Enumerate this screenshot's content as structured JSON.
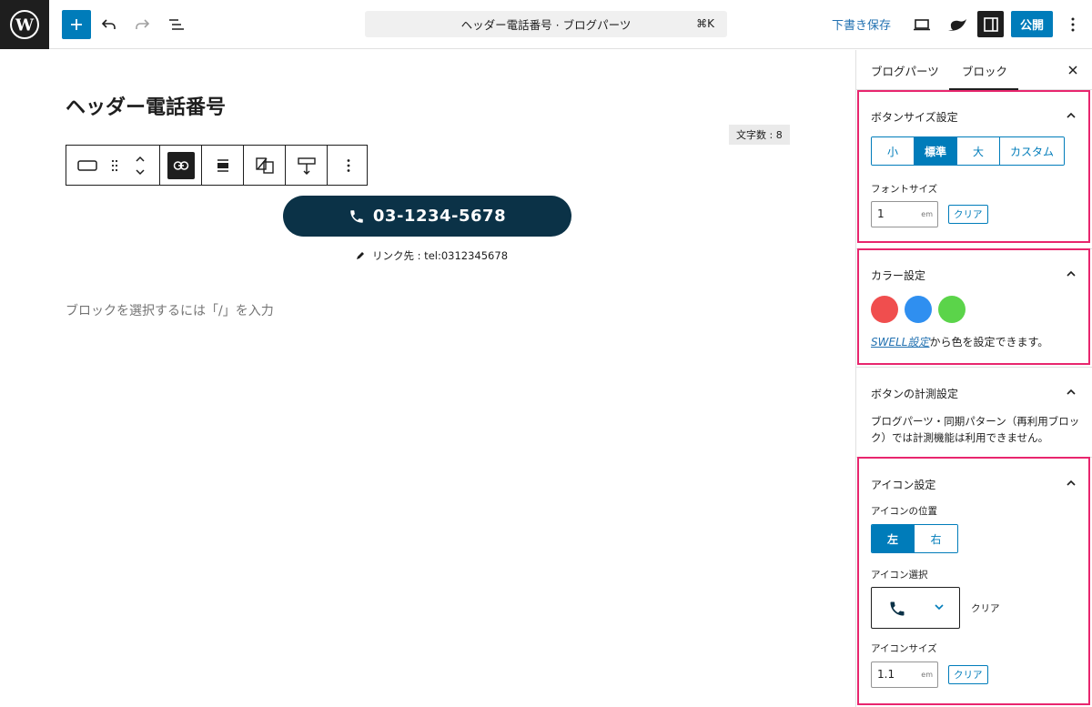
{
  "topbar": {
    "command_bar_text": "ヘッダー電話番号 · ブログパーツ",
    "command_shortcut": "⌘K",
    "save_draft_label": "下書き保存",
    "publish_label": "公開",
    "icons": [
      "wordpress-logo-icon",
      "plus-icon",
      "undo-icon",
      "redo-icon",
      "list-view-icon",
      "preview-icon",
      "swell-icon",
      "sidebar-toggle-icon",
      "more-vertical-icon"
    ]
  },
  "editor": {
    "post_title": "ヘッダー電話番号",
    "char_count": "文字数 : 8",
    "block_toolbar_icons": [
      "button-block-icon",
      "drag-handle-icon",
      "move-up-icon",
      "move-down-icon",
      "link-icon",
      "align-icon",
      "color-swap-icon",
      "spacing-icon",
      "more-vertical-icon"
    ],
    "button_text": "03-1234-5678",
    "button_color": "#0b3247",
    "link_label": "リンク先 : tel:0312345678",
    "block_placeholder": "ブロックを選択するには「/」を入力"
  },
  "sidebar": {
    "tabs": [
      {
        "label": "ブログパーツ"
      },
      {
        "label": "ブロック"
      }
    ],
    "button_size": {
      "heading": "ボタンサイズ設定",
      "options": [
        "小",
        "標準",
        "大",
        "カスタム"
      ],
      "selected": "標準",
      "font_size_label": "フォントサイズ",
      "font_size_value": "1",
      "font_size_unit": "em",
      "clear_label": "クリア"
    },
    "color": {
      "heading": "カラー設定",
      "swatches": [
        "#f04e4e",
        "#2f8ff0",
        "#5bd44a"
      ],
      "note_link": "SWELL設定",
      "note_rest": "から色を設定できます。"
    },
    "tracking": {
      "heading": "ボタンの計測設定",
      "note": "ブログパーツ・同期パターン（再利用ブロック）では計測機能は利用できません。"
    },
    "icon": {
      "heading": "アイコン設定",
      "position_label": "アイコンの位置",
      "position_options": [
        "左",
        "右"
      ],
      "position_selected": "左",
      "select_label": "アイコン選択",
      "select_clear": "クリア",
      "size_label": "アイコンサイズ",
      "size_value": "1.1",
      "size_unit": "em",
      "size_clear": "クリア"
    },
    "highlight_color": "#e8266e",
    "accent_color": "#007cba"
  }
}
